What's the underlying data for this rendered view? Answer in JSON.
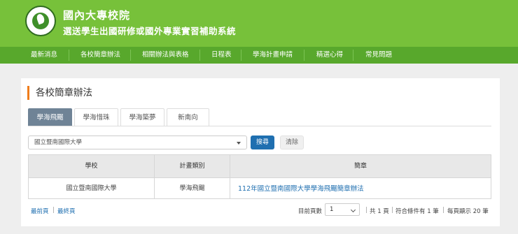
{
  "header": {
    "title_line1": "國內大專校院",
    "title_line2": "選送學生出國研修或國外專業實習補助系統",
    "logo_icon": "ministry-of-education-seal-icon"
  },
  "nav": {
    "items": [
      "最新消息",
      "各校簡章辦法",
      "相關辦法與表格",
      "日程表",
      "學海計畫申請",
      "精選心得",
      "常見問題"
    ]
  },
  "main": {
    "page_title": "各校簡章辦法",
    "tabs": [
      {
        "label": "學海飛颺",
        "active": true
      },
      {
        "label": "學海惜珠",
        "active": false
      },
      {
        "label": "學海築夢",
        "active": false
      },
      {
        "label": "新南向",
        "active": false
      }
    ],
    "filter": {
      "school_select_value": "國立暨南國際大學",
      "search_label": "搜尋",
      "clear_label": "清除"
    },
    "table": {
      "headers": [
        "學校",
        "計畫類別",
        "簡章"
      ],
      "rows": [
        {
          "school": "國立暨南國際大學",
          "category": "學海飛颺",
          "brochure": "112年國立暨南國際大學學海飛颺簡章辦法"
        }
      ]
    },
    "pager": {
      "first_label": "最前頁",
      "sep": "|",
      "last_label": "最終頁",
      "current_page_label": "目前頁數",
      "current_page_value": "1",
      "total_pages_text": "共 1 頁",
      "matches_text": "符合條件有 1 筆",
      "per_page_text": "每頁顯示 20 筆"
    }
  },
  "colors": {
    "header_green": "#77c13a",
    "nav_green": "#58a82c",
    "accent_orange": "#ef7d1b",
    "active_tab": "#6f8396",
    "link_blue": "#1f6fb0"
  }
}
